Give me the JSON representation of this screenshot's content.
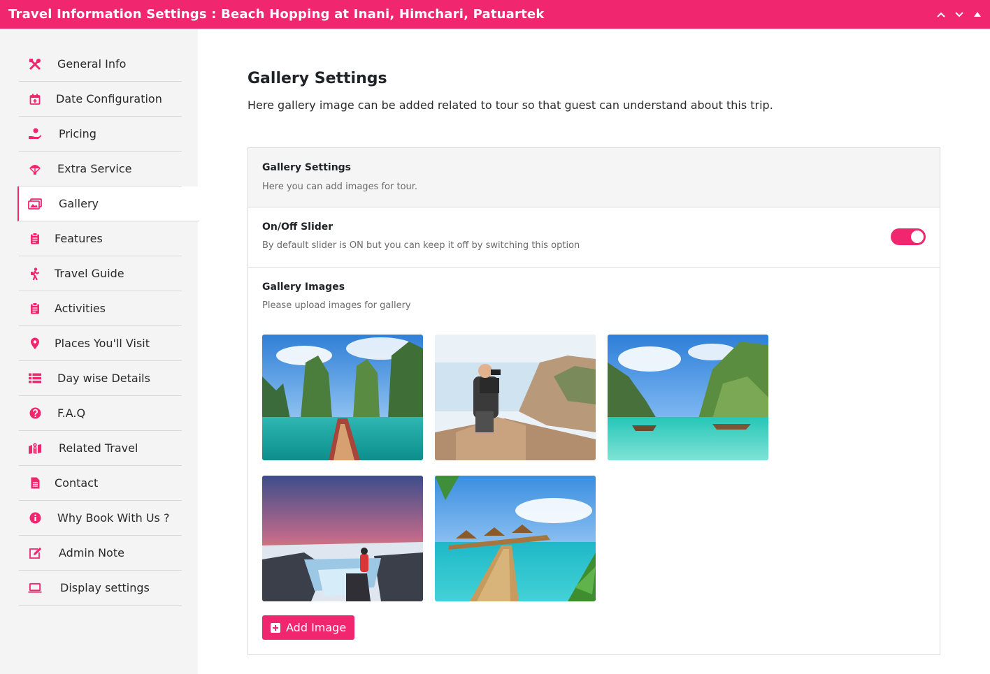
{
  "window": {
    "title": "Travel Information Settings : Beach Hopping at Inani, Himchari, Patuartek",
    "accent": "#f0266f"
  },
  "sidebar": {
    "items": [
      {
        "label": "General Info",
        "icon": "tools-icon"
      },
      {
        "label": "Date Configuration",
        "icon": "calendar-plus-icon"
      },
      {
        "label": "Pricing",
        "icon": "hand-coin-icon"
      },
      {
        "label": "Extra Service",
        "icon": "parachute-icon"
      },
      {
        "label": "Gallery",
        "icon": "images-icon",
        "active": true
      },
      {
        "label": "Features",
        "icon": "clipboard-icon"
      },
      {
        "label": "Travel Guide",
        "icon": "hiker-icon"
      },
      {
        "label": "Activities",
        "icon": "clipboard-icon"
      },
      {
        "label": "Places You'll Visit",
        "icon": "map-pin-icon"
      },
      {
        "label": "Day wise Details",
        "icon": "list-icon"
      },
      {
        "label": "F.A.Q",
        "icon": "question-circle-icon"
      },
      {
        "label": "Related Travel",
        "icon": "map-marker-icon"
      },
      {
        "label": "Contact",
        "icon": "document-icon"
      },
      {
        "label": "Why Book With Us ?",
        "icon": "info-circle-icon"
      },
      {
        "label": "Admin Note",
        "icon": "edit-icon"
      },
      {
        "label": "Display settings",
        "icon": "laptop-icon"
      }
    ]
  },
  "main": {
    "title": "Gallery Settings",
    "description": "Here gallery image can be added related to tour so that guest can understand about this trip."
  },
  "panel": {
    "header": {
      "title": "Gallery Settings",
      "subtitle": "Here you can add images for tour."
    },
    "slider": {
      "title": "On/Off Slider",
      "subtitle": "By default slider is ON but you can keep it off by switching this option",
      "enabled": true
    },
    "images": {
      "title": "Gallery Images",
      "subtitle": "Please upload images for gallery",
      "items": [
        {
          "scene": "lake-rocks-boat"
        },
        {
          "scene": "photographer-coast"
        },
        {
          "scene": "tropical-bay-boats"
        },
        {
          "scene": "waterfall-sunset"
        },
        {
          "scene": "overwater-villas-boardwalk"
        }
      ],
      "add_label": "Add Image"
    }
  }
}
